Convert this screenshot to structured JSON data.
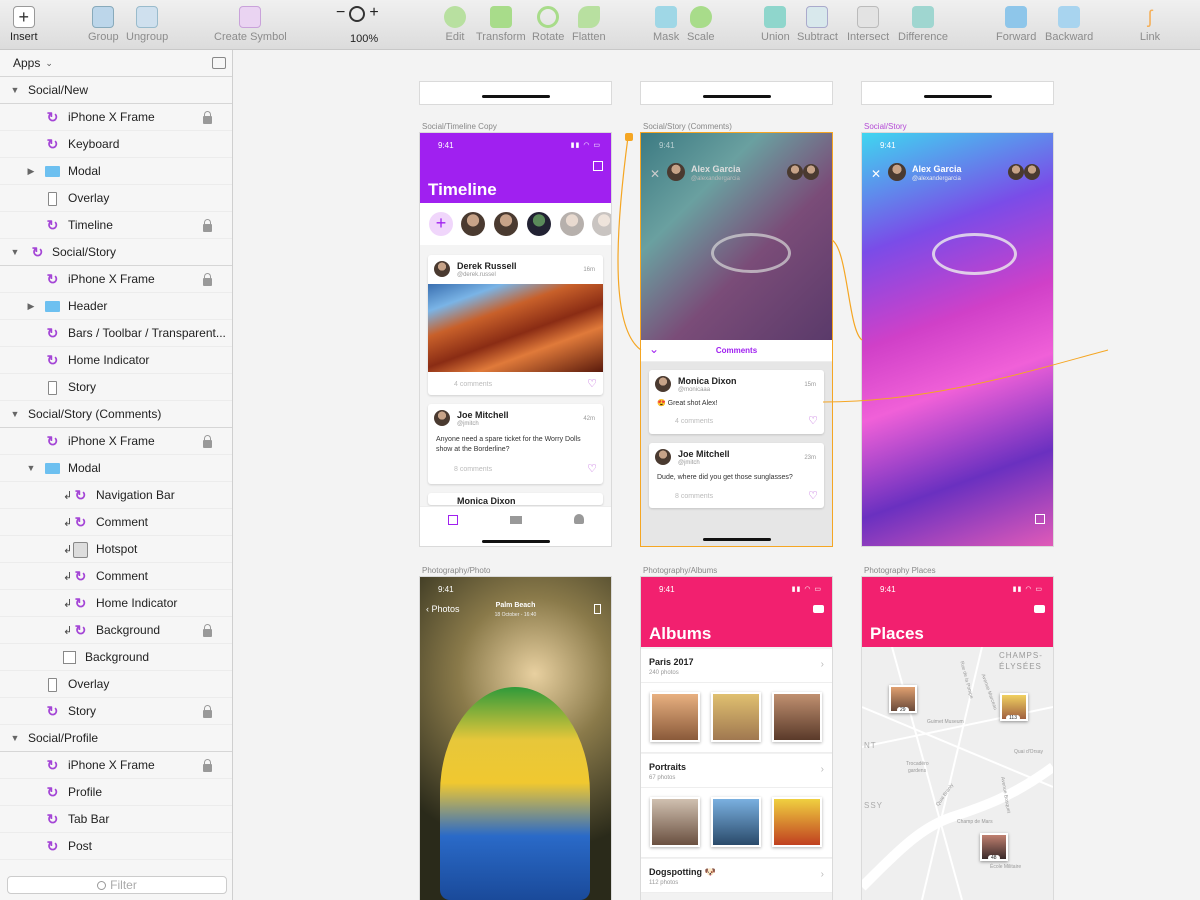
{
  "toolbar": {
    "insert": "Insert",
    "group": "Group",
    "ungroup": "Ungroup",
    "create_symbol": "Create Symbol",
    "zoom_minus": "−",
    "zoom_plus": "+",
    "zoom_level": "100%",
    "edit": "Edit",
    "transform": "Transform",
    "rotate": "Rotate",
    "flatten": "Flatten",
    "mask": "Mask",
    "scale": "Scale",
    "union": "Union",
    "subtract": "Subtract",
    "intersect": "Intersect",
    "difference": "Difference",
    "forward": "Forward",
    "backward": "Backward",
    "link": "Link"
  },
  "sidebar": {
    "page": "Apps",
    "filter_placeholder": "Filter",
    "layers": [
      {
        "label": "Social/New",
        "kind": "group",
        "tri": "▼",
        "indent": 0,
        "icon": "none",
        "lock": false
      },
      {
        "label": "iPhone X Frame",
        "kind": "layer",
        "tri": "",
        "indent": 1,
        "icon": "symbol",
        "lock": true
      },
      {
        "label": "Keyboard",
        "kind": "layer",
        "tri": "",
        "indent": 1,
        "icon": "symbol",
        "lock": false
      },
      {
        "label": "Modal",
        "kind": "layer",
        "tri": "▶",
        "indent": 1,
        "icon": "folder",
        "lock": false
      },
      {
        "label": "Overlay",
        "kind": "layer",
        "tri": "",
        "indent": 1,
        "icon": "rect",
        "lock": false
      },
      {
        "label": "Timeline",
        "kind": "layer",
        "tri": "",
        "indent": 1,
        "icon": "symbol",
        "lock": true
      },
      {
        "label": "Social/Story",
        "kind": "group",
        "tri": "▼",
        "indent": 0,
        "icon": "symbol",
        "lock": false
      },
      {
        "label": "iPhone X Frame",
        "kind": "layer",
        "tri": "",
        "indent": 1,
        "icon": "symbol",
        "lock": true
      },
      {
        "label": "Header",
        "kind": "layer",
        "tri": "▶",
        "indent": 1,
        "icon": "folder",
        "lock": false
      },
      {
        "label": "Bars / Toolbar / Transparent...",
        "kind": "layer",
        "tri": "",
        "indent": 1,
        "icon": "symbol",
        "lock": false
      },
      {
        "label": "Home Indicator",
        "kind": "layer",
        "tri": "",
        "indent": 1,
        "icon": "symbol",
        "lock": false
      },
      {
        "label": "Story",
        "kind": "layer",
        "tri": "",
        "indent": 1,
        "icon": "rect",
        "lock": false
      },
      {
        "label": "Social/Story (Comments)",
        "kind": "group",
        "tri": "▼",
        "indent": 0,
        "icon": "none",
        "lock": false
      },
      {
        "label": "iPhone X Frame",
        "kind": "layer",
        "tri": "",
        "indent": 1,
        "icon": "symbol",
        "lock": true
      },
      {
        "label": "Modal",
        "kind": "layer",
        "tri": "▼",
        "indent": 1,
        "icon": "folder",
        "lock": false
      },
      {
        "label": "Navigation Bar",
        "kind": "layer",
        "tri": "",
        "indent": 2,
        "icon": "symbol",
        "lock": false,
        "arrow": true
      },
      {
        "label": "Comment",
        "kind": "layer",
        "tri": "",
        "indent": 2,
        "icon": "symbol",
        "lock": false,
        "arrow": true
      },
      {
        "label": "Hotspot",
        "kind": "layer",
        "tri": "",
        "indent": 2,
        "icon": "hotspot",
        "lock": false,
        "arrow": true
      },
      {
        "label": "Comment",
        "kind": "layer",
        "tri": "",
        "indent": 2,
        "icon": "symbol",
        "lock": false,
        "arrow": true
      },
      {
        "label": "Home Indicator",
        "kind": "layer",
        "tri": "",
        "indent": 2,
        "icon": "symbol",
        "lock": false,
        "arrow": true
      },
      {
        "label": "Background",
        "kind": "layer",
        "tri": "",
        "indent": 2,
        "icon": "symbol",
        "lock": true,
        "arrow": true
      },
      {
        "label": "Background",
        "kind": "layer",
        "tri": "",
        "indent": 1.5,
        "icon": "square",
        "lock": false
      },
      {
        "label": "Overlay",
        "kind": "layer",
        "tri": "",
        "indent": 1,
        "icon": "rect",
        "lock": false
      },
      {
        "label": "Story",
        "kind": "layer",
        "tri": "",
        "indent": 1,
        "icon": "symbol",
        "lock": true
      },
      {
        "label": "Social/Profile",
        "kind": "group",
        "tri": "▼",
        "indent": 0,
        "icon": "none",
        "lock": false
      },
      {
        "label": "iPhone X Frame",
        "kind": "layer",
        "tri": "",
        "indent": 1,
        "icon": "symbol",
        "lock": true
      },
      {
        "label": "Profile",
        "kind": "layer",
        "tri": "",
        "indent": 1,
        "icon": "symbol",
        "lock": false
      },
      {
        "label": "Tab Bar",
        "kind": "layer",
        "tri": "",
        "indent": 1,
        "icon": "symbol",
        "lock": false
      },
      {
        "label": "Post",
        "kind": "layer",
        "tri": "",
        "indent": 1,
        "icon": "symbol",
        "lock": false
      }
    ]
  },
  "canvas": {
    "labels": {
      "timeline": "Social/Timeline Copy",
      "story_comments": "Social/Story (Comments)",
      "story": "Social/Story",
      "photo": "Photography/Photo",
      "albums": "Photography/Albums",
      "places": "Photography Places"
    },
    "time": "9:41",
    "timeline": {
      "title": "Timeline",
      "post1": {
        "name": "Derek Russell",
        "handle": "@derek.russel",
        "time": "16m",
        "comments": "4 comments"
      },
      "post2": {
        "name": "Joe Mitchell",
        "handle": "@jmitch",
        "time": "42m",
        "body": "Anyone need a spare ticket for the Worry Dolls show at the Borderline?",
        "comments": "8 comments"
      },
      "post3": {
        "name": "Monica Dixon"
      }
    },
    "story_comments": {
      "user": "Alex Garcia",
      "handle": "@alexandergarcia",
      "sheet_title": "Comments",
      "c1": {
        "name": "Monica Dixon",
        "handle": "@monicaaa",
        "time": "15m",
        "body": "😍 Great shot Alex!",
        "comments": "4 comments"
      },
      "c2": {
        "name": "Joe Mitchell",
        "handle": "@jmitch",
        "time": "23m",
        "body": "Dude, where did you get those sunglasses?",
        "comments": "8 comments"
      }
    },
    "story": {
      "user": "Alex Garcia",
      "handle": "@alexandergarcia"
    },
    "photo": {
      "back": "Photos",
      "place": "Palm Beach",
      "date": "18 October - 16:40"
    },
    "albums": {
      "title": "Albums",
      "rows": [
        {
          "title": "Paris 2017",
          "sub": "240 photos"
        },
        {
          "title": "Portraits",
          "sub": "67 photos"
        },
        {
          "title": "Dogspotting 🐶",
          "sub": "112 photos"
        }
      ]
    },
    "places": {
      "title": "Places",
      "map_labels": [
        "CHAMPS-",
        "ÉLYSÉES",
        "Avenue Marceau",
        "Guimet Museum",
        "Quai d'Orsay",
        "Trocadéro",
        "gardens",
        "Champ de Mars",
        "École Militaire",
        "Avenue Bosquet",
        "Quai Branly",
        "Rue de la Pompe",
        "NT",
        "SSY"
      ],
      "pins": [
        "29",
        "113",
        "48"
      ]
    }
  },
  "colors": {
    "purple": "#a020f0",
    "pink": "#f2206f",
    "accent": "#b44bd6",
    "symbol": "#a445d6",
    "folder": "#6dc0f0",
    "connector": "#f5a623"
  }
}
